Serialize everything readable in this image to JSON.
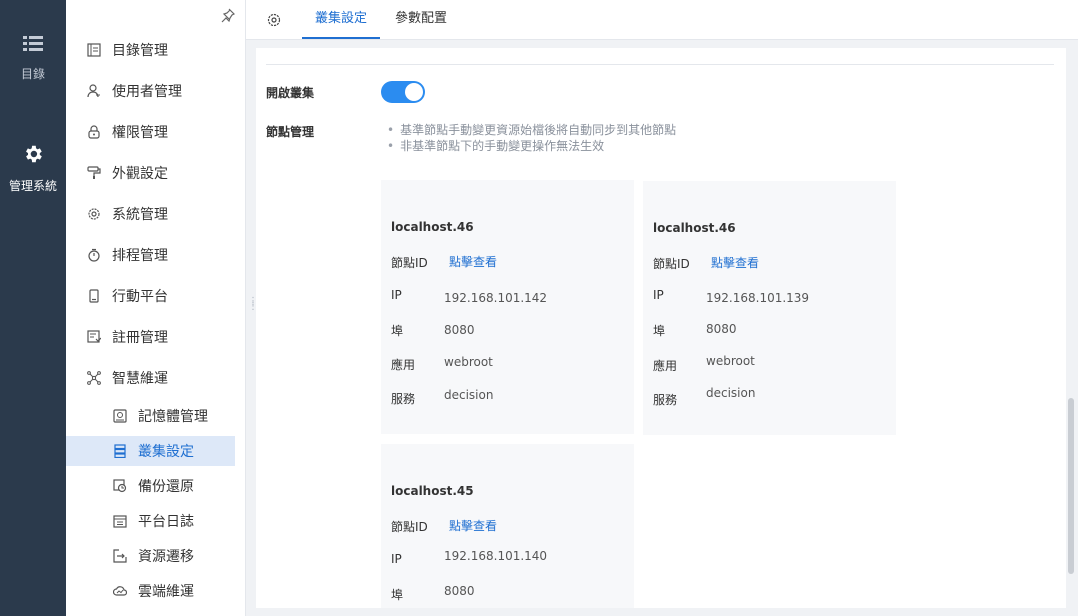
{
  "rail": {
    "catalog": {
      "label": "目錄",
      "icon": "list-icon"
    },
    "manage": {
      "label": "管理系統",
      "icon": "gear-icon"
    }
  },
  "sidebar": {
    "items": [
      {
        "label": "目錄管理",
        "icon": "catalog-icon"
      },
      {
        "label": "使用者管理",
        "icon": "user-icon"
      },
      {
        "label": "權限管理",
        "icon": "lock-icon"
      },
      {
        "label": "外觀設定",
        "icon": "paint-roller-icon"
      },
      {
        "label": "系統管理",
        "icon": "gear-icon"
      },
      {
        "label": "排程管理",
        "icon": "timer-icon"
      },
      {
        "label": "行動平台",
        "icon": "mobile-icon"
      },
      {
        "label": "註冊管理",
        "icon": "register-icon"
      },
      {
        "label": "智慧維運",
        "icon": "network-icon"
      }
    ],
    "sub_items": [
      {
        "label": "記憶體管理",
        "icon": "memory-icon"
      },
      {
        "label": "叢集設定",
        "icon": "cluster-icon",
        "active": true
      },
      {
        "label": "備份還原",
        "icon": "backup-icon"
      },
      {
        "label": "平台日誌",
        "icon": "log-icon"
      },
      {
        "label": "資源遷移",
        "icon": "migrate-icon"
      },
      {
        "label": "雲端維運",
        "icon": "cloud-icon"
      }
    ]
  },
  "tabs": [
    {
      "label": "叢集設定",
      "active": true
    },
    {
      "label": "參數配置",
      "active": false
    }
  ],
  "content": {
    "cluster_enable_label": "開啟叢集",
    "cluster_enabled": true,
    "node_manage_label": "節點管理",
    "hints": [
      "基準節點手動變更資源始檔後將自動同步到其他節點",
      "非基準節點下的手動變更操作無法生效"
    ],
    "row_labels": {
      "node_id": "節點ID",
      "ip": "IP",
      "port": "埠",
      "app": "應用",
      "service": "服務"
    },
    "view_link": "點擊查看",
    "nodes": [
      {
        "title": "localhost.46",
        "ip": "192.168.101.142",
        "port": "8080",
        "app": "webroot",
        "service": "decision"
      },
      {
        "title": "localhost.46",
        "ip": "192.168.101.139",
        "port": "8080",
        "app": "webroot",
        "service": "decision"
      },
      {
        "title": "localhost.45",
        "ip": "192.168.101.140",
        "port": "8080"
      }
    ]
  },
  "colors": {
    "rail_bg": "#2b3a4c",
    "accent": "#1f6fd1",
    "toggle_on": "#2b8cf0",
    "active_item_bg": "#dde8f8"
  }
}
